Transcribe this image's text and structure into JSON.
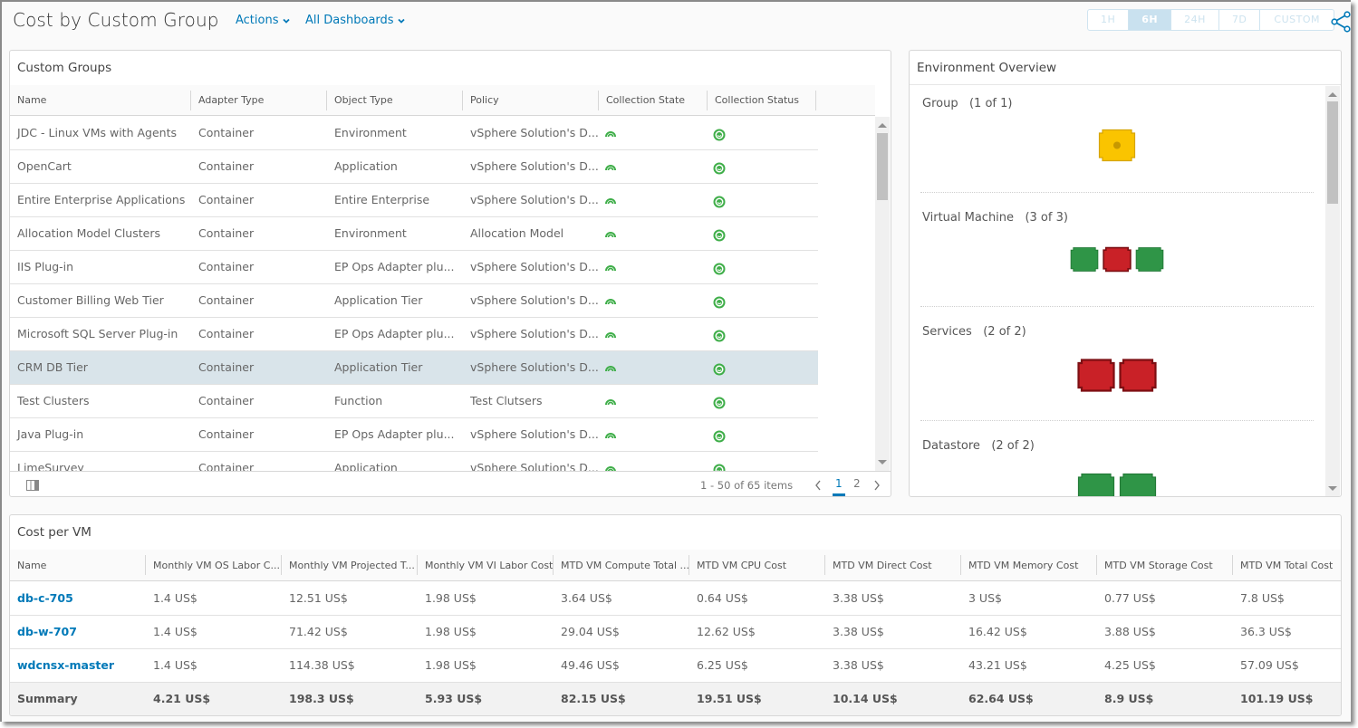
{
  "header": {
    "title": "Cost by Custom Group",
    "actions_label": "Actions",
    "dashboards_label": "All Dashboards",
    "time_ranges": [
      "1H",
      "6H",
      "24H",
      "7D",
      "CUSTOM"
    ],
    "active_time_range": "6H",
    "share_icon": "share-icon"
  },
  "custom_groups": {
    "title": "Custom Groups",
    "columns": [
      "Name",
      "Adapter Type",
      "Object Type",
      "Policy",
      "Collection State",
      "Collection Status"
    ],
    "rows": [
      {
        "name": "JDC - Linux VMs with Agents",
        "adapter": "Container",
        "object": "Environment",
        "policy": "vSphere Solution's D...",
        "state": "collecting",
        "status": "ok"
      },
      {
        "name": "OpenCart",
        "adapter": "Container",
        "object": "Application",
        "policy": "vSphere Solution's D...",
        "state": "collecting",
        "status": "ok"
      },
      {
        "name": "Entire Enterprise Applications",
        "adapter": "Container",
        "object": "Entire Enterprise",
        "policy": "vSphere Solution's D...",
        "state": "collecting",
        "status": "ok"
      },
      {
        "name": "Allocation Model Clusters",
        "adapter": "Container",
        "object": "Environment",
        "policy": "Allocation Model",
        "state": "collecting",
        "status": "ok"
      },
      {
        "name": "IIS Plug-in",
        "adapter": "Container",
        "object": "EP Ops Adapter plu...",
        "policy": "vSphere Solution's D...",
        "state": "collecting",
        "status": "ok"
      },
      {
        "name": "Customer Billing Web Tier",
        "adapter": "Container",
        "object": "Application Tier",
        "policy": "vSphere Solution's D...",
        "state": "collecting",
        "status": "ok"
      },
      {
        "name": "Microsoft SQL Server Plug-in",
        "adapter": "Container",
        "object": "EP Ops Adapter plu...",
        "policy": "vSphere Solution's D...",
        "state": "collecting",
        "status": "ok"
      },
      {
        "name": "CRM DB Tier",
        "adapter": "Container",
        "object": "Application Tier",
        "policy": "vSphere Solution's D...",
        "state": "collecting",
        "status": "ok",
        "selected": true
      },
      {
        "name": "Test Clusters",
        "adapter": "Container",
        "object": "Function",
        "policy": "Test Clutsers",
        "state": "collecting",
        "status": "ok"
      },
      {
        "name": "Java Plug-in",
        "adapter": "Container",
        "object": "EP Ops Adapter plu...",
        "policy": "vSphere Solution's D...",
        "state": "collecting",
        "status": "ok"
      },
      {
        "name": "LimeSurvey",
        "adapter": "Container",
        "object": "Application",
        "policy": "vSphere Solution's D...",
        "state": "collecting",
        "status": "ok"
      }
    ],
    "pagination": {
      "summary": "1 - 50 of 65 items",
      "pages": [
        "1",
        "2"
      ],
      "current_page": "1"
    },
    "colors": {
      "status_green": "#3fae49"
    }
  },
  "environment_overview": {
    "title": "Environment Overview",
    "sections": [
      {
        "label": "Group",
        "count": "(1 of 1)",
        "badges": [
          "yellow"
        ]
      },
      {
        "label": "Virtual Machine",
        "count": "(3 of 3)",
        "badges": [
          "green",
          "red",
          "green"
        ]
      },
      {
        "label": "Services",
        "count": "(2 of 2)",
        "badges": [
          "red",
          "red"
        ]
      },
      {
        "label": "Datastore",
        "count": "(2 of 2)",
        "badges": [
          "green",
          "green"
        ]
      }
    ],
    "colors": {
      "yellow": "#fac400",
      "red": "#c92127",
      "green": "#2f9547"
    }
  },
  "cost_per_vm": {
    "title": "Cost per VM",
    "columns": [
      "Name",
      "Monthly VM OS Labor C...",
      "Monthly VM Projected T...",
      "Monthly VM VI Labor Cost",
      "MTD VM Compute Total ...",
      "MTD VM CPU Cost",
      "MTD VM Direct Cost",
      "MTD VM Memory Cost",
      "MTD VM Storage Cost",
      "MTD VM Total Cost"
    ],
    "rows": [
      [
        "db-c-705",
        "1.4 US$",
        "12.51 US$",
        "1.98 US$",
        "3.64 US$",
        "0.64 US$",
        "3.38 US$",
        "3 US$",
        "0.77 US$",
        "7.8 US$"
      ],
      [
        "db-w-707",
        "1.4 US$",
        "71.42 US$",
        "1.98 US$",
        "29.04 US$",
        "12.62 US$",
        "3.38 US$",
        "16.42 US$",
        "3.88 US$",
        "36.3 US$"
      ],
      [
        "wdcnsx-master",
        "1.4 US$",
        "114.38 US$",
        "1.98 US$",
        "49.46 US$",
        "6.25 US$",
        "3.38 US$",
        "43.21 US$",
        "4.25 US$",
        "57.09 US$"
      ]
    ],
    "summary": [
      "Summary",
      "4.21 US$",
      "198.3 US$",
      "5.93 US$",
      "82.15 US$",
      "19.51 US$",
      "10.14 US$",
      "62.64 US$",
      "8.9 US$",
      "101.19 US$"
    ]
  }
}
